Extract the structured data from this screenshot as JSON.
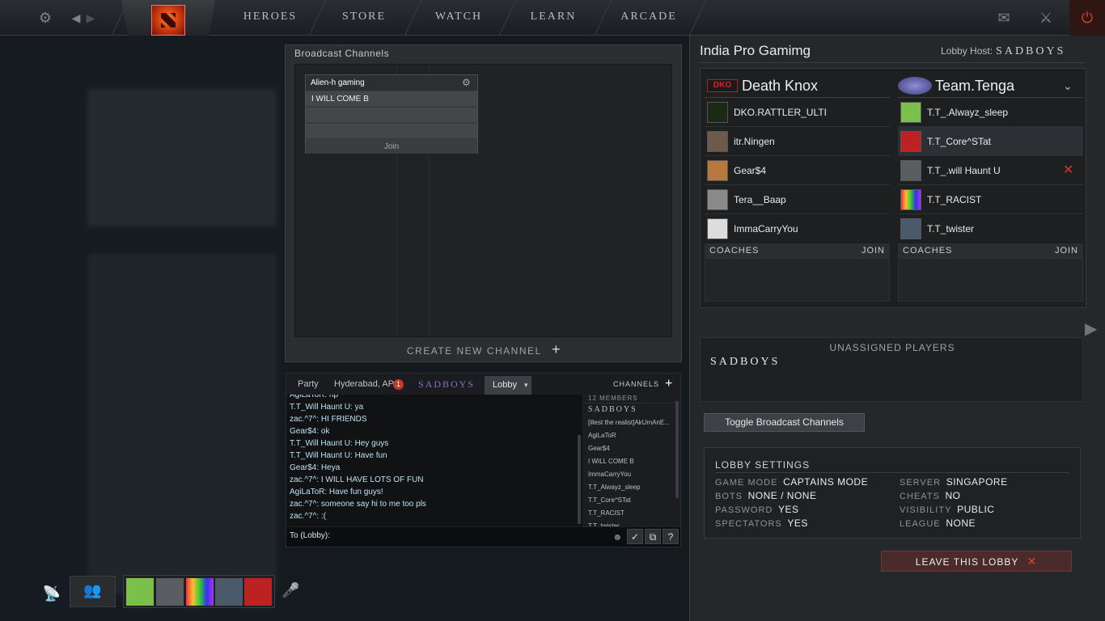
{
  "nav": {
    "items": [
      "HEROES",
      "STORE",
      "WATCH",
      "LEARN",
      "ARCADE"
    ]
  },
  "broadcast": {
    "title": "Broadcast Channels",
    "channel": {
      "name": "Alien-h gaming",
      "message": "I WILL COME B",
      "join_label": "Join"
    },
    "create_label": "CREATE NEW CHANNEL",
    "plus": "+"
  },
  "chat": {
    "tabs": {
      "party": "Party",
      "location": "Hyderabad, AP",
      "location_badge": "1",
      "team": "SADBOYS",
      "lobby": "Lobby"
    },
    "channels_label": "CHANNELS",
    "channels_plus": "+",
    "messages": [
      "AgiLaToR: hp",
      "T.T_Will Haunt U: ya",
      "zac.^7^: HI FRIENDS",
      "Gear$4: ok",
      "T.T_Will Haunt U: Hey guys",
      "T.T_Will Haunt U: Have fun",
      "Gear$4: Heya",
      "zac.^7^: I WILL HAVE LOTS OF FUN",
      "AgiLaToR: Have fun guys!",
      "zac.^7^: someone say hi to me too pls",
      "zac.^7^: :("
    ],
    "members_count": "12 MEMBERS",
    "members": [
      "SADBOYS",
      "[illest the realist]AkUmAnE...",
      "AgiLaToR",
      "Gear$4",
      "I WILL COME B",
      "ImmaCarryYou",
      "T.T_Alwayz_sleep",
      "T.T_Core^STat",
      "T.T_RACIST",
      "T.T_twister"
    ],
    "input_label": "To (Lobby):",
    "help": "?"
  },
  "lobby": {
    "name": "India Pro Gamimg",
    "host_label": "Lobby Host:",
    "host_name": "SADBOYS",
    "team1": {
      "name": "Death Knox",
      "players": [
        "DKO.RATTLER_ULTI",
        "itr.Ningen",
        "Gear$4",
        "Tera__Baap",
        "ImmaCarryYou"
      ],
      "coaches_label": "COACHES",
      "join_label": "JOIN"
    },
    "team2": {
      "name": "Team.Tenga",
      "players": [
        "T.T_.Alwayz_sleep",
        "T.T_Core^STat",
        "T.T_.will Haunt U",
        "T.T_RACIST",
        "T.T_twister"
      ],
      "coaches_label": "COACHES",
      "join_label": "JOIN"
    },
    "unassigned_label": "UNASSIGNED PLAYERS",
    "unassigned_players": [
      "SADBOYS"
    ],
    "toggle_label": "Toggle Broadcast Channels",
    "settings": {
      "title": "LOBBY SETTINGS",
      "left": [
        {
          "k": "GAME MODE",
          "v": "CAPTAINS MODE"
        },
        {
          "k": "BOTS",
          "v": "NONE / NONE"
        },
        {
          "k": "PASSWORD",
          "v": "YES"
        },
        {
          "k": "SPECTATORS",
          "v": "YES"
        }
      ],
      "right": [
        {
          "k": "SERVER",
          "v": "SINGAPORE"
        },
        {
          "k": "CHEATS",
          "v": "NO"
        },
        {
          "k": "VISIBILITY",
          "v": "PUBLIC"
        },
        {
          "k": "LEAGUE",
          "v": "NONE"
        }
      ]
    },
    "leave_label": "LEAVE THIS LOBBY"
  },
  "colors": {
    "accent_purple": "#8a6fc9",
    "leave_red": "#c0392b",
    "chat_text": "#bde3f2"
  }
}
